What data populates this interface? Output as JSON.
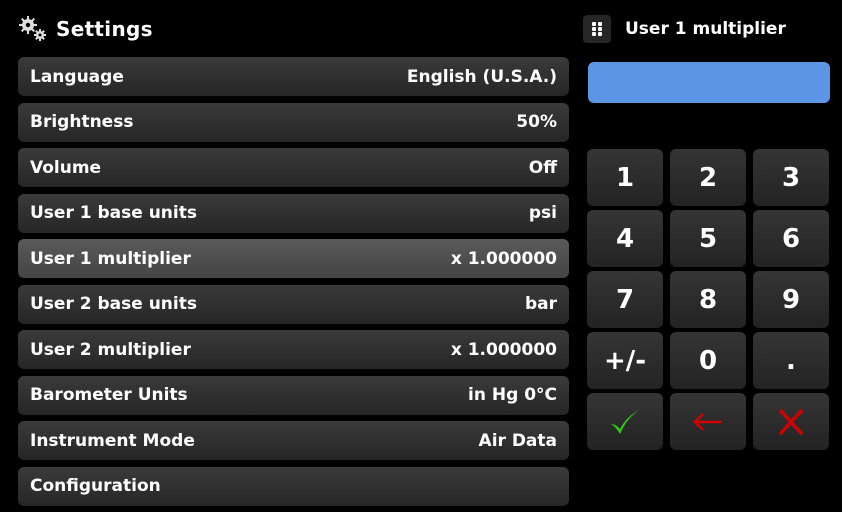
{
  "header": {
    "title": "Settings",
    "icon": "gears-icon"
  },
  "settings": {
    "rows": [
      {
        "label": "Language",
        "value": "English (U.S.A.)"
      },
      {
        "label": "Brightness",
        "value": "50%"
      },
      {
        "label": "Volume",
        "value": "Off"
      },
      {
        "label": "User 1 base units",
        "value": "psi"
      },
      {
        "label": "User 1 multiplier",
        "value": "x 1.000000"
      },
      {
        "label": "User 2 base units",
        "value": "bar"
      },
      {
        "label": "User 2 multiplier",
        "value": "x 1.000000"
      },
      {
        "label": "Barometer Units",
        "value": "in Hg 0°C"
      },
      {
        "label": "Instrument Mode",
        "value": "Air Data"
      },
      {
        "label": "Configuration",
        "value": ""
      }
    ],
    "selected_index": 4
  },
  "keypad": {
    "title": "User 1 multiplier",
    "entry_value": "",
    "entry_color": "#5b95e3",
    "keys": [
      "1",
      "2",
      "3",
      "4",
      "5",
      "6",
      "7",
      "8",
      "9",
      "+/-",
      "0",
      "."
    ],
    "action_icons": [
      "checkmark-icon",
      "backspace-arrow-icon",
      "cancel-x-icon"
    ],
    "colors": {
      "confirm": "#2ecc1a",
      "back": "#d40000",
      "cancel": "#d40000"
    }
  }
}
